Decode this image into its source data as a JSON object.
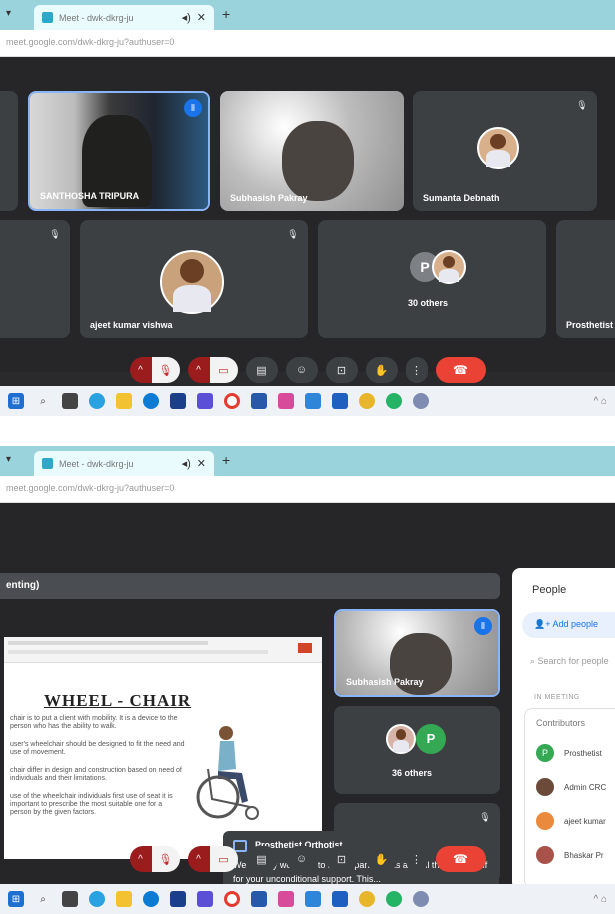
{
  "top": {
    "tab_title": "Meet - dwk-dkrg-ju",
    "url": "meet.google.com/dwk-dkrg-ju?authuser=0",
    "participants": [
      {
        "name": "SANTHOSHA TRIPURA"
      },
      {
        "name": "Subhasish Pakray"
      },
      {
        "name": "Sumanta Debnath"
      },
      {
        "name": "ajeet kumar vishwa"
      },
      {
        "name": "Prosthetist"
      }
    ],
    "others_label": "30 others",
    "others_initial": "P"
  },
  "bottom": {
    "tab_title": "Meet - dwk-dkrg-ju",
    "url": "meet.google.com/dwk-dkrg-ju?authuser=0",
    "presenting_label": "enting)",
    "presenter_tile": "Subhasish Pakray",
    "others_label": "36 others",
    "others_initial": "P",
    "slide": {
      "heading": "WHEEL - CHAIR",
      "para1": "chair is to put a client with mobility. It is a device to the person who has the ability to walk.",
      "para2": "user's wheelchair should be designed to fit the need and use of movement.",
      "para3": "chair differ in design and construction based on need of individuals and their limitations.",
      "para4": "use of the wheelchair individuals first use of seat it is important to prescribe the most suitable one for a person by the given factors."
    },
    "people_panel": {
      "title": "People",
      "add_label": "Add people",
      "search_placeholder": "Search for people",
      "section": "IN MEETING",
      "sub": "Contributors",
      "rows": [
        {
          "initial": "P",
          "name": "Prosthetist",
          "color": "#34a853"
        },
        {
          "initial": "",
          "name": "Admin CRC",
          "color": "#6b4a3a"
        },
        {
          "initial": "",
          "name": "ajeet kumar",
          "color": "#ea8a3c"
        },
        {
          "initial": "",
          "name": "Bhaskar Pr",
          "color": "#a8524a"
        }
      ]
    },
    "toast": {
      "sender": "Prosthetist Orthotist",
      "message": "We warmly welcome to all the participants and all the CRC Staff for your unconditional support. This..."
    }
  },
  "colors": {
    "end_call": "#ea4335",
    "mic_off": "#9b1c1c",
    "accent": "#1a73e8"
  }
}
